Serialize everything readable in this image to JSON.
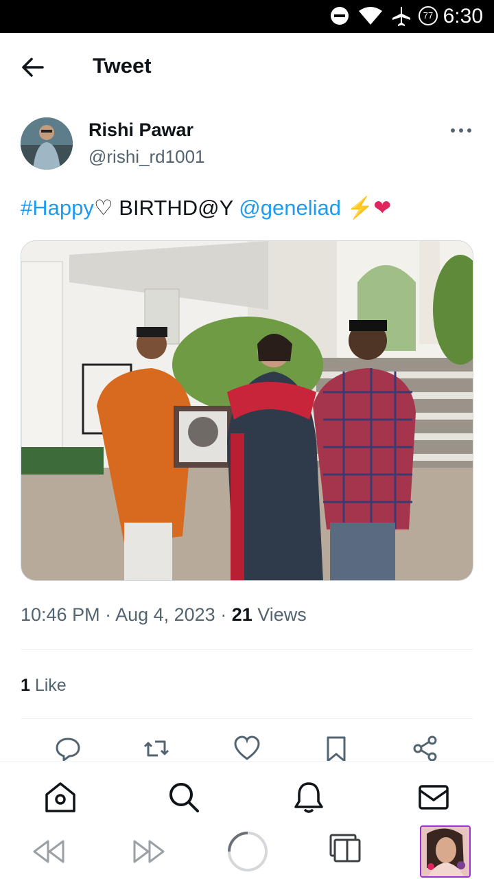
{
  "status_bar": {
    "time": "6:30",
    "battery_level": "77",
    "icons": [
      "do-not-disturb-icon",
      "wifi-icon",
      "airplane-mode-icon",
      "battery-icon"
    ]
  },
  "header": {
    "title": "Tweet"
  },
  "tweet": {
    "author_name": "Rishi Pawar",
    "author_handle": "@rishi_rd1001",
    "text_parts": {
      "hashtag": "#Happy",
      "heart_outline": "♡",
      "middle": " BIRTHD@Y ",
      "mention": "@geneliad",
      "emoji": " ⚡❤"
    },
    "timestamp": "10:46 PM · Aug 4, 2023 · ",
    "views_count": "21",
    "views_label": " Views",
    "likes_count": "1",
    "likes_label": " Like"
  },
  "colors": {
    "link": "#1d9bf0",
    "secondary_text": "#536471",
    "primary_text": "#0f1419",
    "thumb_border": "#9b30d9"
  },
  "actions": [
    "reply-icon",
    "retweet-icon",
    "like-icon",
    "bookmark-icon",
    "share-icon"
  ],
  "bottom_nav": [
    "home-icon",
    "search-icon",
    "notifications-icon",
    "messages-icon"
  ],
  "system_toolbar": [
    "rewind-icon",
    "fast-forward-icon",
    "loading-spinner",
    "multi-window-icon",
    "recent-app-thumbnail"
  ]
}
